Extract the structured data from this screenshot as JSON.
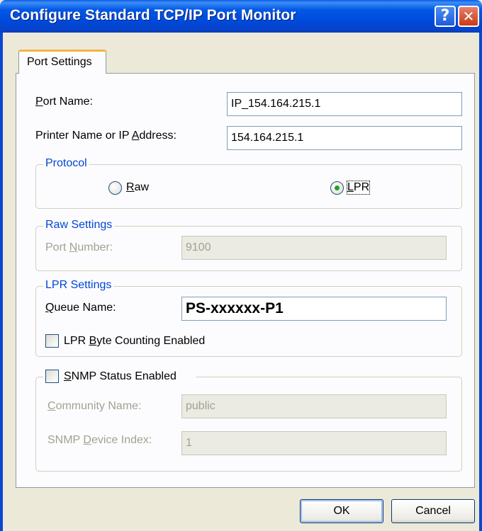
{
  "window": {
    "title": "Configure Standard TCP/IP Port Monitor",
    "help_glyph": "?",
    "close_glyph": "✕",
    "accent_color": "#0058e6"
  },
  "tabs": [
    {
      "label": "Port Settings",
      "selected": true
    }
  ],
  "fields": {
    "port_name": {
      "label": "Port Name:",
      "value": "IP_154.164.215.1"
    },
    "printer_address": {
      "label": "Printer Name or IP Address:",
      "value": "154.164.215.1"
    }
  },
  "protocol": {
    "legend": "Protocol",
    "options": [
      {
        "label": "Raw",
        "selected": false
      },
      {
        "label": "LPR",
        "selected": true
      }
    ]
  },
  "raw_settings": {
    "legend": "Raw Settings",
    "port_number_label": "Port Number:",
    "port_number_value": "9100",
    "enabled": false
  },
  "lpr_settings": {
    "legend": "LPR Settings",
    "queue_name_label": "Queue Name:",
    "queue_name_value": "PS-xxxxxx-P1",
    "byte_counting_label": "LPR Byte Counting Enabled",
    "byte_counting_checked": false
  },
  "snmp": {
    "status_label": "SNMP Status Enabled",
    "status_checked": false,
    "community_label": "Community Name:",
    "community_value": "public",
    "device_index_label": "SNMP Device Index:",
    "device_index_value": "1",
    "enabled": false
  },
  "buttons": {
    "ok": "OK",
    "cancel": "Cancel"
  }
}
